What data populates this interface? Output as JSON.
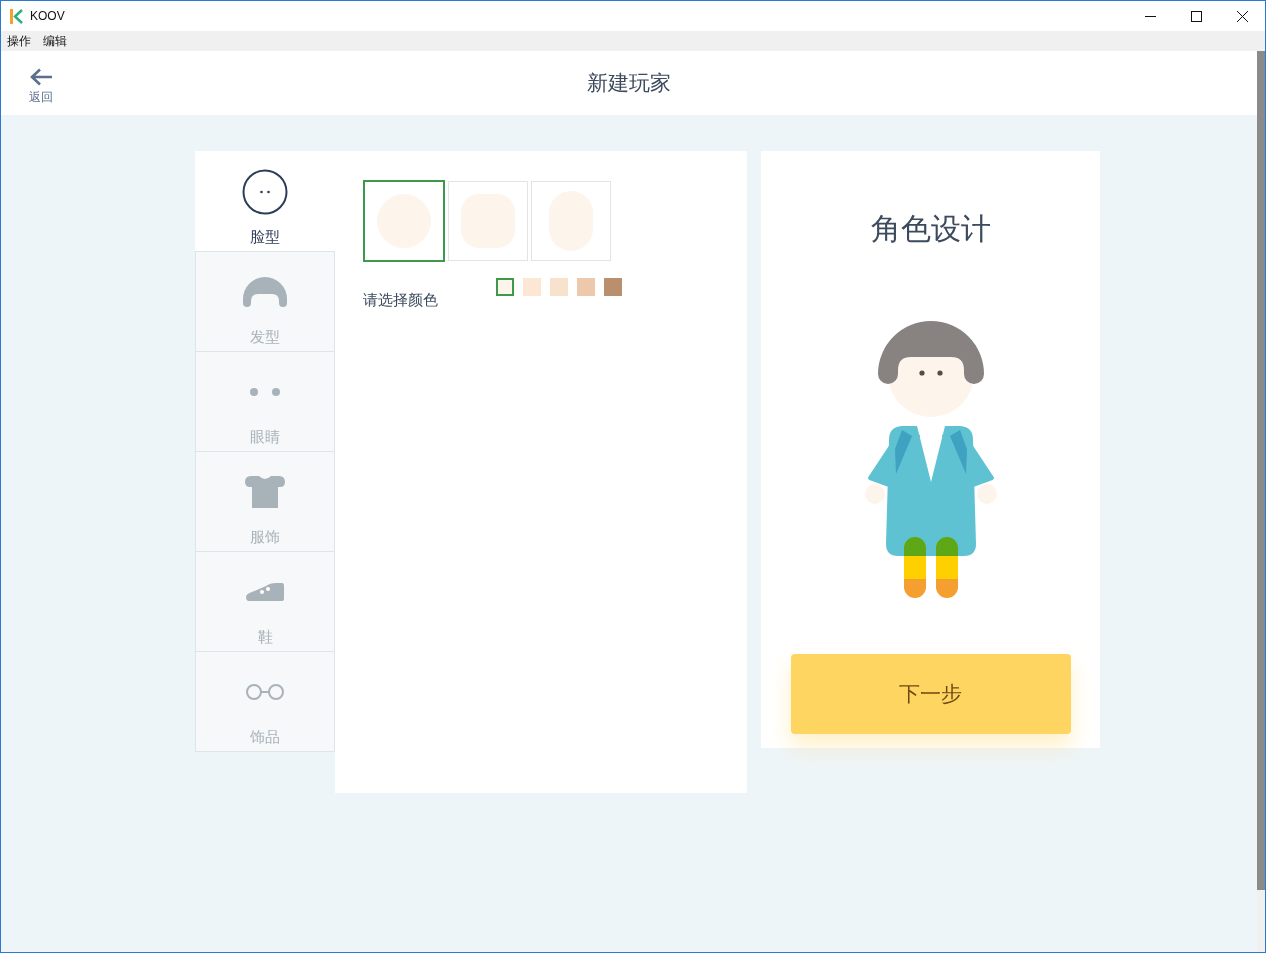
{
  "window": {
    "title": "KOOV"
  },
  "menu": [
    "操作",
    "编辑"
  ],
  "header": {
    "back_label": "返回",
    "title": "新建玩家"
  },
  "categories": [
    {
      "kind": "face",
      "label": "脸型",
      "selected": true
    },
    {
      "kind": "hair",
      "label": "发型",
      "selected": false
    },
    {
      "kind": "eyes",
      "label": "眼睛",
      "selected": false
    },
    {
      "kind": "clothes",
      "label": "服饰",
      "selected": false
    },
    {
      "kind": "shoes",
      "label": "鞋",
      "selected": false
    },
    {
      "kind": "accessories",
      "label": "饰品",
      "selected": false
    }
  ],
  "face_shapes": [
    {
      "kind": "round",
      "selected": true
    },
    {
      "kind": "rounded-square",
      "selected": false
    },
    {
      "kind": "oval",
      "selected": false
    }
  ],
  "color_prompt": "请选择颜色",
  "skin_colors": [
    {
      "color": "#fdf4ec",
      "selected": true
    },
    {
      "color": "#fbe7d3",
      "selected": false
    },
    {
      "color": "#f9e2cd",
      "selected": false
    },
    {
      "color": "#edc8ab",
      "selected": false
    },
    {
      "color": "#b98f6d",
      "selected": false
    }
  ],
  "preview": {
    "title": "角色设计",
    "next_button": "下一步"
  }
}
